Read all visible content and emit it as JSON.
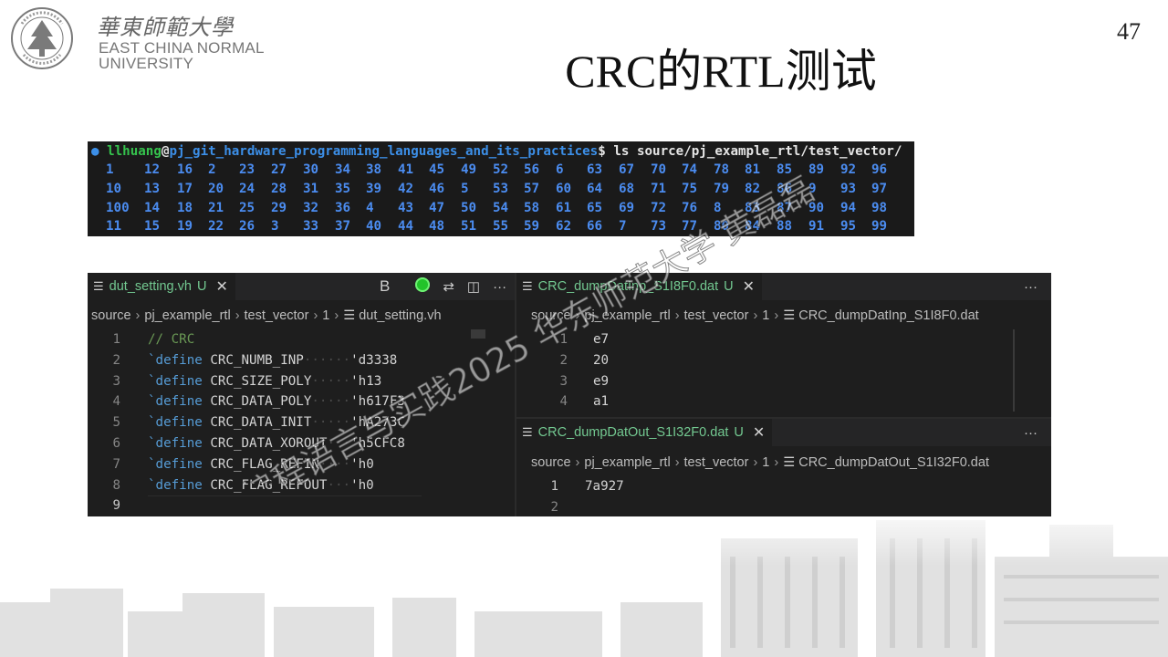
{
  "logo": {
    "cn": "華東師範大學",
    "en_line1": "EAST CHINA NORMAL",
    "en_line2": "UNIVERSITY",
    "seal_text": "EAST CHINA NORMAL UNIVERSITY"
  },
  "page_number": "47",
  "title": "CRC的RTL测试",
  "terminal": {
    "user": "llhuang",
    "at": "@",
    "path": "pj_git_hardware_programming_languages_and_its_practices",
    "prompt": "$ ls source/pj_example_rtl/test_vector/",
    "rows": [
      [
        "1",
        "12",
        "16",
        "2",
        "23",
        "27",
        "30",
        "34",
        "38",
        "41",
        "45",
        "49",
        "52",
        "56",
        "6",
        "63",
        "67",
        "70",
        "74",
        "78",
        "81",
        "85",
        "89",
        "92",
        "96"
      ],
      [
        "10",
        "13",
        "17",
        "20",
        "24",
        "28",
        "31",
        "35",
        "39",
        "42",
        "46",
        "5",
        "53",
        "57",
        "60",
        "64",
        "68",
        "71",
        "75",
        "79",
        "82",
        "86",
        "9",
        "93",
        "97"
      ],
      [
        "100",
        "14",
        "18",
        "21",
        "25",
        "29",
        "32",
        "36",
        "4",
        "43",
        "47",
        "50",
        "54",
        "58",
        "61",
        "65",
        "69",
        "72",
        "76",
        "8",
        "83",
        "87",
        "90",
        "94",
        "98"
      ],
      [
        "11",
        "15",
        "19",
        "22",
        "26",
        "3",
        "33",
        "37",
        "40",
        "44",
        "48",
        "51",
        "55",
        "59",
        "62",
        "66",
        "7",
        "73",
        "77",
        "80",
        "84",
        "88",
        "91",
        "95",
        "99"
      ]
    ]
  },
  "left_editor": {
    "tab_label": "dut_setting.vh",
    "tab_status": "U",
    "actions": [
      "B",
      "copilot-icon",
      "git-compare-icon",
      "split-editor-icon",
      "···"
    ],
    "breadcrumb": [
      "source",
      "pj_example_rtl",
      "test_vector",
      "1",
      "dut_setting.vh"
    ],
    "lines": [
      {
        "n": "1",
        "comment": "// CRC"
      },
      {
        "n": "2",
        "kw": "`define",
        "name": "CRC_NUMB_INP",
        "val": "'d3338"
      },
      {
        "n": "3",
        "kw": "`define",
        "name": "CRC_SIZE_POLY",
        "val": "'h13"
      },
      {
        "n": "4",
        "kw": "`define",
        "name": "CRC_DATA_POLY",
        "val": "'h617F3"
      },
      {
        "n": "5",
        "kw": "`define",
        "name": "CRC_DATA_INIT",
        "val": "'hA273C"
      },
      {
        "n": "6",
        "kw": "`define",
        "name": "CRC_DATA_XOROUT",
        "val": "'h5CFC8"
      },
      {
        "n": "7",
        "kw": "`define",
        "name": "CRC_FLAG_REFIN",
        "val": "'h0"
      },
      {
        "n": "8",
        "kw": "`define",
        "name": "CRC_FLAG_REFOUT",
        "val": "'h0"
      },
      {
        "n": "9"
      }
    ]
  },
  "right_top_editor": {
    "tab_label": "CRC_dumpDatInp_S1I8F0.dat",
    "tab_status": "U",
    "more": "···",
    "breadcrumb": [
      "source",
      "pj_example_rtl",
      "test_vector",
      "1",
      "CRC_dumpDatInp_S1I8F0.dat"
    ],
    "lines": [
      {
        "n": "1",
        "text": "e7"
      },
      {
        "n": "2",
        "text": "20"
      },
      {
        "n": "3",
        "text": "e9"
      },
      {
        "n": "4",
        "text": "a1"
      }
    ]
  },
  "right_bottom_editor": {
    "tab_label": "CRC_dumpDatOut_S1I32F0.dat",
    "tab_status": "U",
    "more": "···",
    "breadcrumb": [
      "source",
      "pj_example_rtl",
      "test_vector",
      "1",
      "CRC_dumpDatOut_S1I32F0.dat"
    ],
    "lines": [
      {
        "n": "1",
        "text": "7a927"
      },
      {
        "n": "2",
        "text": ""
      }
    ]
  },
  "watermark": "硬件编程语言与实践2025 华东师范大学 黄磊磊",
  "colors": {
    "terminal_bg": "#1a1a1a",
    "terminal_blue": "#4b8cf0",
    "terminal_green": "#35c24d",
    "editor_bg": "#1e1e1e",
    "untracked_green": "#73c991",
    "keyword_blue": "#569cd6",
    "comment_green": "#6a9955"
  }
}
